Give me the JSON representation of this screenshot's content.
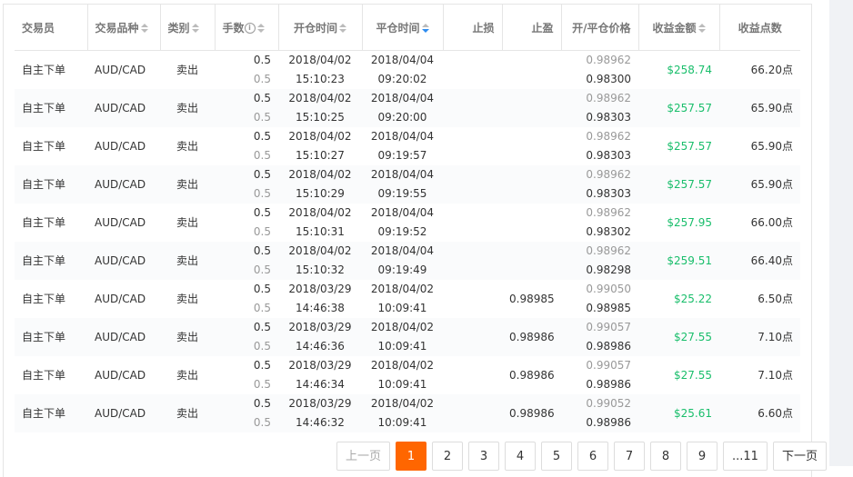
{
  "headers": {
    "trader": "交易员",
    "symbol": "交易品种",
    "type": "类别",
    "lots": "手数",
    "open_time": "开仓时间",
    "close_time": "平仓时间",
    "sl": "止损",
    "tp": "止盈",
    "price": "开/平仓价格",
    "profit": "收益金额",
    "points": "收益点数"
  },
  "rows": [
    {
      "trader": "自主下单",
      "symbol": "AUD/CAD",
      "type": "卖出",
      "lots": "0.5",
      "lots2": "0.5",
      "open_date": "2018/04/02",
      "open_time": "15:10:23",
      "close_date": "2018/04/04",
      "close_time": "09:20:02",
      "sl": "",
      "tp": "",
      "open_price": "0.98962",
      "close_price": "0.98300",
      "profit": "$258.74",
      "points": "66.20点"
    },
    {
      "trader": "自主下单",
      "symbol": "AUD/CAD",
      "type": "卖出",
      "lots": "0.5",
      "lots2": "0.5",
      "open_date": "2018/04/02",
      "open_time": "15:10:25",
      "close_date": "2018/04/04",
      "close_time": "09:20:00",
      "sl": "",
      "tp": "",
      "open_price": "0.98962",
      "close_price": "0.98303",
      "profit": "$257.57",
      "points": "65.90点"
    },
    {
      "trader": "自主下单",
      "symbol": "AUD/CAD",
      "type": "卖出",
      "lots": "0.5",
      "lots2": "0.5",
      "open_date": "2018/04/02",
      "open_time": "15:10:27",
      "close_date": "2018/04/04",
      "close_time": "09:19:57",
      "sl": "",
      "tp": "",
      "open_price": "0.98962",
      "close_price": "0.98303",
      "profit": "$257.57",
      "points": "65.90点"
    },
    {
      "trader": "自主下单",
      "symbol": "AUD/CAD",
      "type": "卖出",
      "lots": "0.5",
      "lots2": "0.5",
      "open_date": "2018/04/02",
      "open_time": "15:10:29",
      "close_date": "2018/04/04",
      "close_time": "09:19:55",
      "sl": "",
      "tp": "",
      "open_price": "0.98962",
      "close_price": "0.98303",
      "profit": "$257.57",
      "points": "65.90点"
    },
    {
      "trader": "自主下单",
      "symbol": "AUD/CAD",
      "type": "卖出",
      "lots": "0.5",
      "lots2": "0.5",
      "open_date": "2018/04/02",
      "open_time": "15:10:31",
      "close_date": "2018/04/04",
      "close_time": "09:19:52",
      "sl": "",
      "tp": "",
      "open_price": "0.98962",
      "close_price": "0.98302",
      "profit": "$257.95",
      "points": "66.00点"
    },
    {
      "trader": "自主下单",
      "symbol": "AUD/CAD",
      "type": "卖出",
      "lots": "0.5",
      "lots2": "0.5",
      "open_date": "2018/04/02",
      "open_time": "15:10:32",
      "close_date": "2018/04/04",
      "close_time": "09:19:49",
      "sl": "",
      "tp": "",
      "open_price": "0.98962",
      "close_price": "0.98298",
      "profit": "$259.51",
      "points": "66.40点"
    },
    {
      "trader": "自主下单",
      "symbol": "AUD/CAD",
      "type": "卖出",
      "lots": "0.5",
      "lots2": "0.5",
      "open_date": "2018/03/29",
      "open_time": "14:46:38",
      "close_date": "2018/04/02",
      "close_time": "10:09:41",
      "sl": "",
      "tp": "0.98985",
      "open_price": "0.99050",
      "close_price": "0.98985",
      "profit": "$25.22",
      "points": "6.50点"
    },
    {
      "trader": "自主下单",
      "symbol": "AUD/CAD",
      "type": "卖出",
      "lots": "0.5",
      "lots2": "0.5",
      "open_date": "2018/03/29",
      "open_time": "14:46:36",
      "close_date": "2018/04/02",
      "close_time": "10:09:41",
      "sl": "",
      "tp": "0.98986",
      "open_price": "0.99057",
      "close_price": "0.98986",
      "profit": "$27.55",
      "points": "7.10点"
    },
    {
      "trader": "自主下单",
      "symbol": "AUD/CAD",
      "type": "卖出",
      "lots": "0.5",
      "lots2": "0.5",
      "open_date": "2018/03/29",
      "open_time": "14:46:34",
      "close_date": "2018/04/02",
      "close_time": "10:09:41",
      "sl": "",
      "tp": "0.98986",
      "open_price": "0.99057",
      "close_price": "0.98986",
      "profit": "$27.55",
      "points": "7.10点"
    },
    {
      "trader": "自主下单",
      "symbol": "AUD/CAD",
      "type": "卖出",
      "lots": "0.5",
      "lots2": "0.5",
      "open_date": "2018/03/29",
      "open_time": "14:46:32",
      "close_date": "2018/04/02",
      "close_time": "10:09:41",
      "sl": "",
      "tp": "0.98986",
      "open_price": "0.99052",
      "close_price": "0.98986",
      "profit": "$25.61",
      "points": "6.60点"
    }
  ],
  "pagination": {
    "prev": "上一页",
    "pages": [
      "1",
      "2",
      "3",
      "4",
      "5",
      "6",
      "7",
      "8",
      "9",
      "...11"
    ],
    "current": "1",
    "next": "下一页"
  },
  "colors": {
    "accent": "#ff6600",
    "profit": "#19be6b",
    "sort_active": "#2d8cf0"
  }
}
